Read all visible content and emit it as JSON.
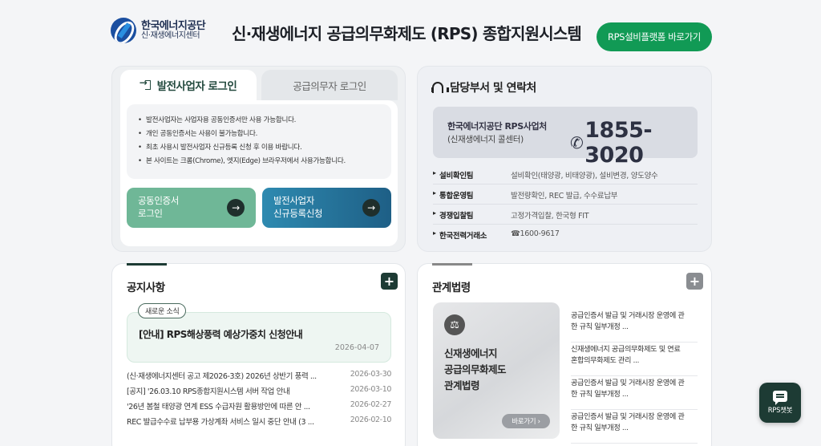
{
  "header": {
    "logo_line1": "한국에너지공단",
    "logo_line2": "신·재생에너지센터",
    "site_title": "신·재생에너지 공급의무화제도 (RPS) 종합지원시스템",
    "platform_button": "RPS설비플랫폼 바로가기"
  },
  "login": {
    "tab_active": "발전사업자 로그인",
    "tab_inactive": "공급의무자 로그인",
    "notices": [
      "발전사업자는 사업자용 공동인증서만 사용 가능합니다.",
      "개인 공동인증서는 사용이 불가능합니다.",
      "최초 사용시 발전사업자 신규등록 신청 후 이용 바랍니다.",
      "본 사이트는 크롬(Chrome), 엣지(Edge) 브라우저에서 사용가능합니다."
    ],
    "cert_button_l1": "공동인증서",
    "cert_button_l2": "로그인",
    "reg_button_l1": "발전사업자",
    "reg_button_l2": "신규등록신청",
    "arrow_glyph": "→"
  },
  "contact": {
    "title": "담당부서 및 연락처",
    "org": "한국에너지공단 RPS사업처",
    "org_sub": "(신재생에너지 콜센터)",
    "phone": "1855-3020",
    "phone_glyph": "✆",
    "departments": [
      {
        "name": "설비확인팀",
        "desc": "설비확인(태양광, 비태양광), 설비변경, 양도양수"
      },
      {
        "name": "통합운영팀",
        "desc": "발전량확인, REC 발급, 수수료납부"
      },
      {
        "name": "경쟁입찰팀",
        "desc": "고정가격입찰, 한국형 FIT"
      },
      {
        "name": "한국전력거래소",
        "desc": "☎1600-9617"
      }
    ]
  },
  "notices": {
    "title": "공지사항",
    "plus": "+",
    "badge": "새로운 소식",
    "featured_title": "[안내] RPS해상풍력 예상가중치 신청안내",
    "featured_date": "2026-04-07",
    "items": [
      {
        "title": "(신·재생에너지센터 공고 제2026-3호) 2026년 상반기 풍력 ...",
        "date": "2026-03-30"
      },
      {
        "title": "[공지] '26.03.10 RPS종합지원시스템 서버 작업 안내",
        "date": "2026-03-10"
      },
      {
        "title": "'26년 봄철 태양광 연계 ESS 수급자원 활용방안에 따른 안 ...",
        "date": "2026-02-27"
      },
      {
        "title": "REC 발급수수료 납부용 가상계좌 서비스 일시 중단 안내 (3 ...",
        "date": "2026-02-10"
      }
    ]
  },
  "laws": {
    "title": "관계법령",
    "plus": "+",
    "scale_glyph": "⚖",
    "caption_l1": "신재생에너지",
    "caption_l2": "공급의무화제도",
    "caption_l3": "관계법령",
    "go_link": "바로가기 ›",
    "items": [
      {
        "l1": "공급인증서 발급 및 거래시장 운영에 관",
        "l2": "한 규칙 일부개정 ..."
      },
      {
        "l1": "신재생에너지 공급의무화제도 및 연료",
        "l2": "혼합의무화제도 관리 ..."
      },
      {
        "l1": "공급인증서 발급 및 거래시장 운영에 관",
        "l2": "한 규칙 일부개정 ..."
      },
      {
        "l1": "공급인증서 발급 및 거래시장 운영에 관",
        "l2": "한 규칙 일부개정 ..."
      }
    ]
  },
  "chatbot": {
    "label": "RPS챗봇"
  }
}
